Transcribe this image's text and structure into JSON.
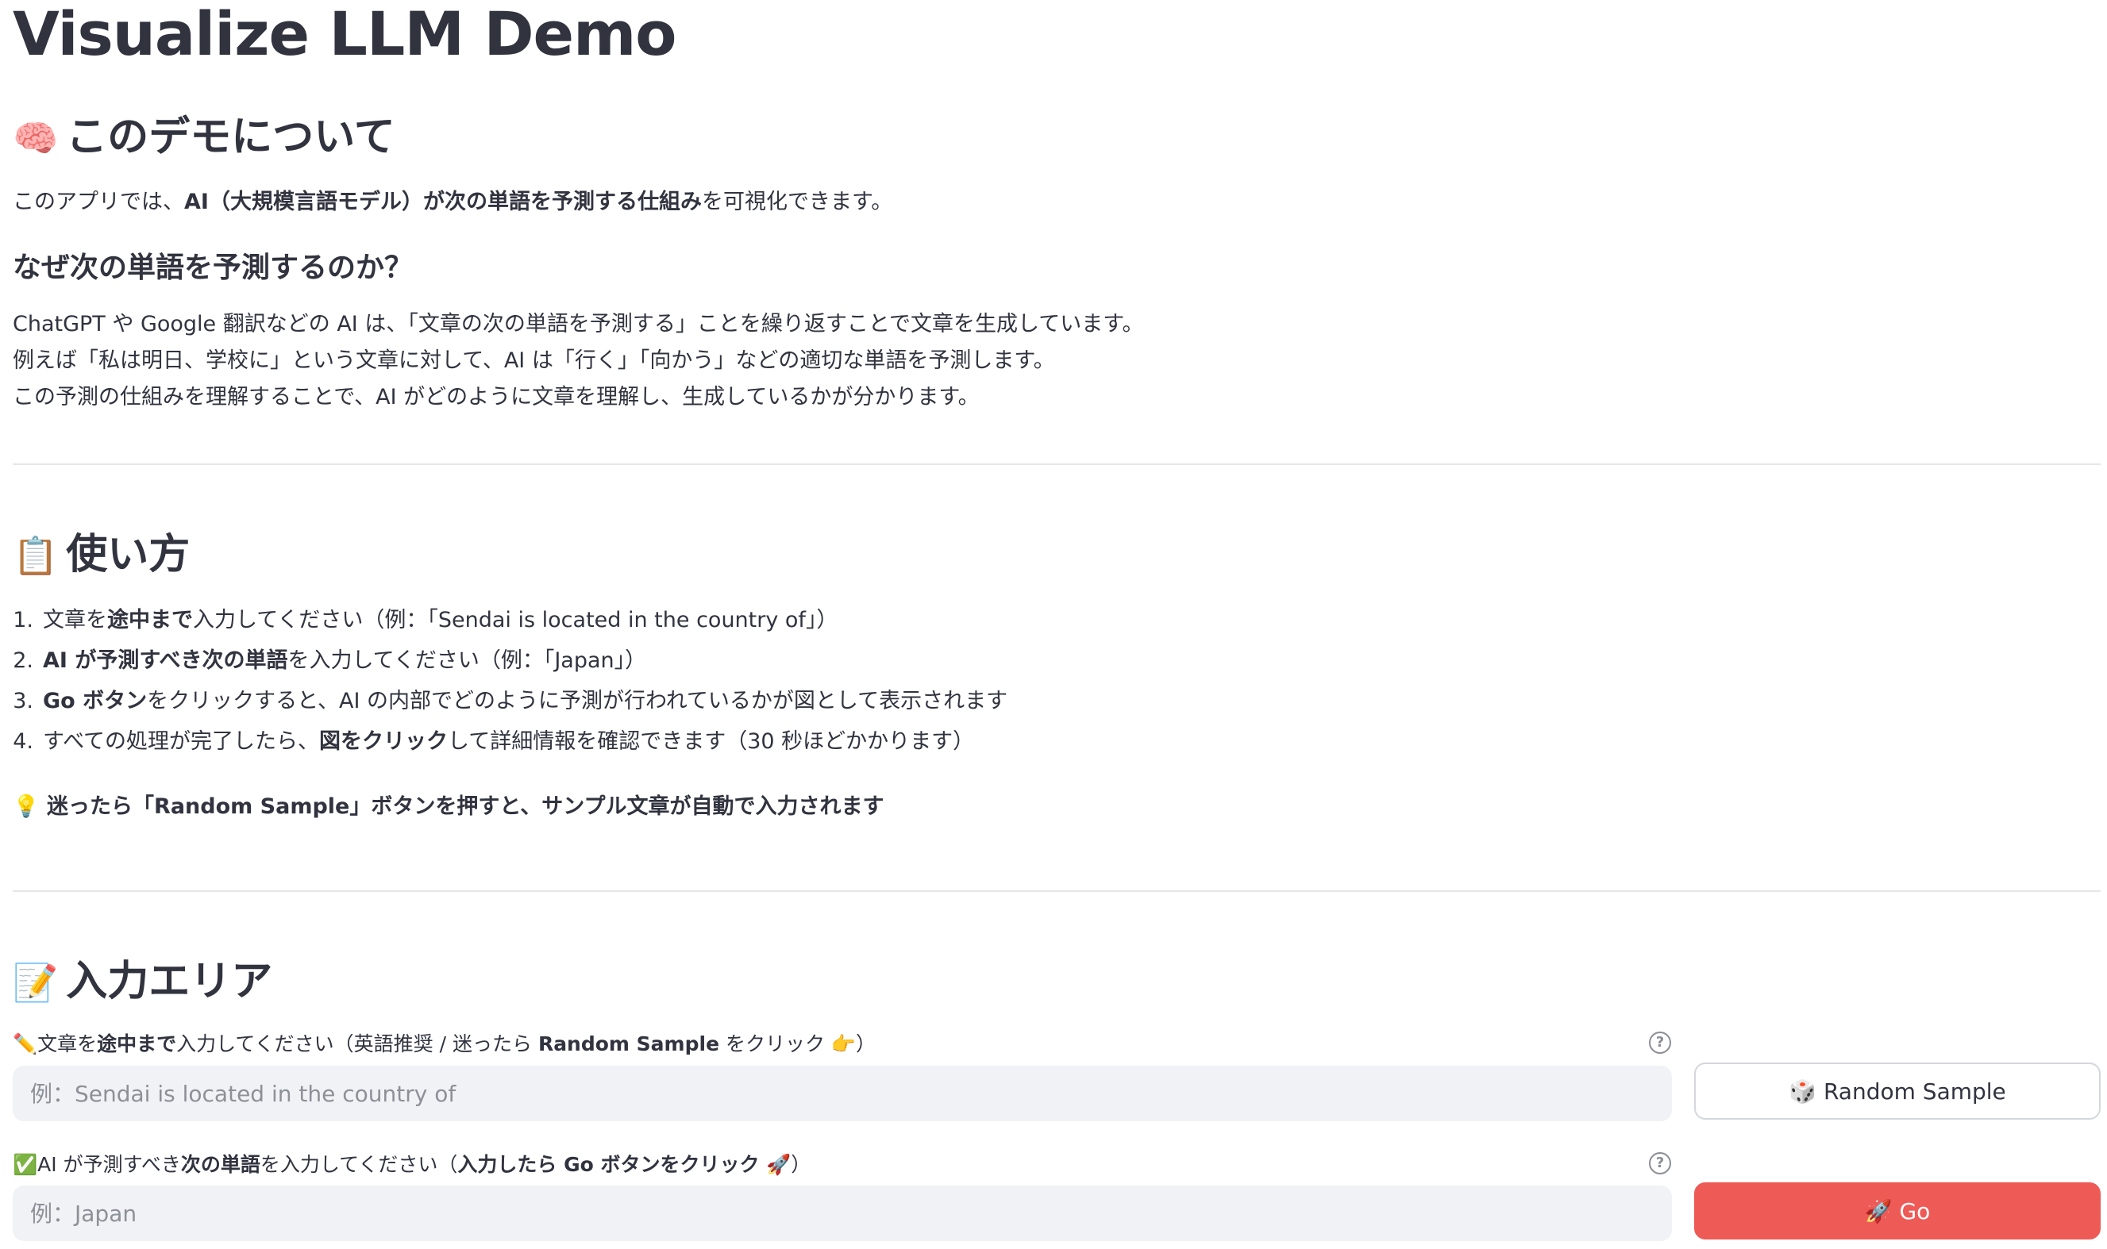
{
  "app": {
    "title": "Visualize LLM Demo"
  },
  "about": {
    "emoji": "🧠",
    "heading": "このデモについて",
    "intro": {
      "pre": "このアプリでは、",
      "bold": "AI（大規模言語モデル）が次の単語を予測する仕組み",
      "post": "を可視化できます。"
    },
    "why_heading": "なぜ次の単語を予測するのか？",
    "lines": [
      "ChatGPT や Google 翻訳などの AI は、「文章の次の単語を予測する」ことを繰り返すことで文章を生成しています。",
      "例えば「私は明日、学校に」という文章に対して、AI は「行く」「向かう」などの適切な単語を予測します。",
      "この予測の仕組みを理解することで、AI がどのように文章を理解し、生成しているかが分かります。"
    ]
  },
  "usage": {
    "emoji": "📋",
    "heading": "使い方",
    "steps": [
      {
        "num": "1.",
        "pre": "文章を",
        "bold": "途中まで",
        "post": "入力してください（例：「Sendai is located in the country of」）"
      },
      {
        "num": "2.",
        "pre": "",
        "bold": "AI が予測すべき次の単語",
        "post": "を入力してください（例：「Japan」）"
      },
      {
        "num": "3.",
        "pre": "",
        "bold": "Go ボタン",
        "post": "をクリックすると、AI の内部でどのように予測が行われているかが図として表示されます"
      },
      {
        "num": "4.",
        "pre": "すべての処理が完了したら、",
        "bold": "図をクリック",
        "post": "して詳細情報を確認できます（30 秒ほどかかります）"
      }
    ],
    "tip_emoji": "💡",
    "tip": "迷ったら「Random Sample」ボタンを押すと、サンプル文章が自動で入力されます"
  },
  "input_area": {
    "emoji": "📝",
    "heading": "入力エリア",
    "field1": {
      "emoji": "✏️",
      "label": {
        "pre": "文章を",
        "bold": "途中まで",
        "mid": "入力してください（英語推奨 / 迷ったら ",
        "bold2": "Random Sample",
        "post": " をクリック 👉）"
      },
      "placeholder": "例：Sendai is located in the country of",
      "value": ""
    },
    "field2": {
      "emoji": "✅",
      "label": {
        "pre": "AI が予測すべき",
        "bold": "次の単語",
        "mid": "を入力してください（",
        "bold2": "入力したら Go ボタンをクリック 🚀",
        "post": "）"
      },
      "placeholder": "例：Japan",
      "value": ""
    },
    "help_icon": "?",
    "random_button": "🎲 Random Sample",
    "go_button": "🚀 Go"
  },
  "colors": {
    "primary": "#ee5a56",
    "text": "#31333f",
    "input_bg": "#f0f2f6",
    "divider": "#e6e6ea"
  }
}
